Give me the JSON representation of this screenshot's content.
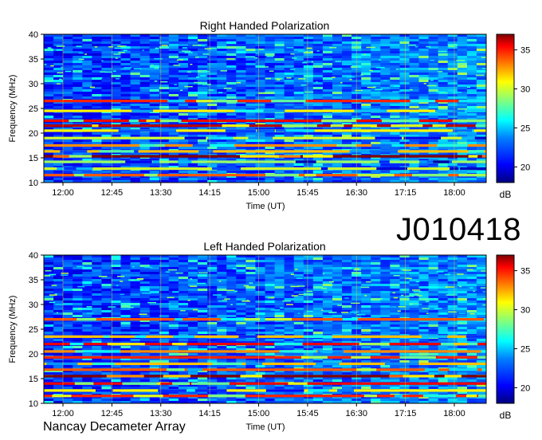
{
  "observation_id": "J010418",
  "credit": "Nancay Decameter Array",
  "colors": {
    "colormap": [
      "#00007f",
      "#0000ff",
      "#007fff",
      "#00ffff",
      "#7fff7f",
      "#ffff00",
      "#ff7f00",
      "#ff0000",
      "#7f0000"
    ]
  },
  "chart_data": [
    {
      "type": "heatmap",
      "title": "Right Handed Polarization",
      "xlabel": "Time (UT)",
      "ylabel": "Frequency (MHz)",
      "x_ticks": [
        "12:00",
        "12:45",
        "13:30",
        "14:15",
        "15:00",
        "15:45",
        "16:30",
        "17:15",
        "18:00"
      ],
      "y_ticks": [
        10,
        15,
        20,
        25,
        30,
        35,
        40
      ],
      "ylim": [
        10,
        40
      ],
      "colorbar": {
        "label": "dB",
        "ticks": [
          20,
          25,
          30,
          35
        ],
        "range": [
          18,
          37
        ]
      },
      "bands": [
        {
          "f": 26.5,
          "level": 34
        },
        {
          "f": 24.5,
          "level": 30
        },
        {
          "f": 22.5,
          "level": 35
        },
        {
          "f": 21.5,
          "level": 36
        },
        {
          "f": 20.5,
          "level": 30
        },
        {
          "f": 19.0,
          "level": 29
        },
        {
          "f": 17.5,
          "level": 32
        },
        {
          "f": 16.3,
          "level": 31
        },
        {
          "f": 15.3,
          "level": 37
        },
        {
          "f": 14.2,
          "level": 28
        },
        {
          "f": 12.8,
          "level": 29
        },
        {
          "f": 11.5,
          "level": 33
        }
      ]
    },
    {
      "type": "heatmap",
      "title": "Left Handed Polarization",
      "xlabel": "Time (UT)",
      "ylabel": "Frequency (MHz)",
      "x_ticks": [
        "12:00",
        "12:45",
        "13:30",
        "14:15",
        "15:00",
        "15:45",
        "16:30",
        "17:15",
        "18:00"
      ],
      "y_ticks": [
        10,
        15,
        20,
        25,
        30,
        35,
        40
      ],
      "ylim": [
        10,
        40
      ],
      "colorbar": {
        "label": "dB",
        "ticks": [
          20,
          25,
          30,
          35
        ],
        "range": [
          18,
          37
        ]
      },
      "bands": [
        {
          "f": 27.0,
          "level": 33
        },
        {
          "f": 23.5,
          "level": 31
        },
        {
          "f": 22.0,
          "level": 35
        },
        {
          "f": 20.5,
          "level": 32
        },
        {
          "f": 19.3,
          "level": 34
        },
        {
          "f": 18.0,
          "level": 31
        },
        {
          "f": 16.8,
          "level": 33
        },
        {
          "f": 15.5,
          "level": 37
        },
        {
          "f": 14.0,
          "level": 35
        },
        {
          "f": 12.6,
          "level": 30
        },
        {
          "f": 11.5,
          "level": 34
        }
      ]
    }
  ]
}
